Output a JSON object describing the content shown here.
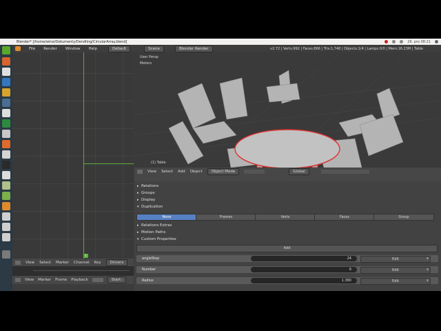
{
  "os_bar": {
    "title": "Blender* [/home/wine/Dokumenty/Dendling/CircularArray.blend]",
    "clock": "26. pro 08:21"
  },
  "menu": {
    "items": [
      "File",
      "Render",
      "Window",
      "Help"
    ],
    "layout": "Default",
    "scene": "Scene",
    "engine": "Blender Render",
    "stats": "v2.72 | Verts:992 | Faces:866 | Tris:1,748 | Objects:1/4 | Lamps:0/0 | Mem:16.23M | Table"
  },
  "viewport": {
    "persp": "User Persp",
    "units": "Meters",
    "object_label": "(1) Table"
  },
  "viewport_header": {
    "items": [
      "View",
      "Select",
      "Add",
      "Object"
    ],
    "mode": "Object Mode",
    "orientation": "Global"
  },
  "graph_header": {
    "items": [
      "View",
      "Select",
      "Marker",
      "Channel",
      "Key"
    ],
    "drivers": "Drivers"
  },
  "timeline_header": {
    "items": [
      "View",
      "Marker",
      "Frame",
      "Playback"
    ],
    "start": "Start:"
  },
  "graph": {
    "frame": "1"
  },
  "properties": {
    "panels": [
      {
        "label": "Relations",
        "expanded": false
      },
      {
        "label": "Groups",
        "expanded": false
      },
      {
        "label": "Display",
        "expanded": false
      },
      {
        "label": "Duplication",
        "expanded": true
      }
    ],
    "duplication_tabs": [
      "None",
      "Frames",
      "Verts",
      "Faces",
      "Group"
    ],
    "duplication_selected": "None",
    "panels2": [
      {
        "label": "Relations Extras",
        "expanded": false
      },
      {
        "label": "Motion Paths",
        "expanded": false
      },
      {
        "label": "Custom Properties",
        "expanded": true
      }
    ],
    "add_label": "Add",
    "custom_props": [
      {
        "name": "angleStep",
        "value": "24",
        "edit": "Edit",
        "remove": "x"
      },
      {
        "name": "Number",
        "value": "6",
        "edit": "Edit",
        "remove": "x"
      },
      {
        "name": "Radius",
        "value": "1.380",
        "edit": "Edit",
        "remove": "x"
      }
    ]
  },
  "colors": {
    "selection": "#e03030",
    "accent": "#5680c2",
    "curve": "#5fae3b"
  }
}
